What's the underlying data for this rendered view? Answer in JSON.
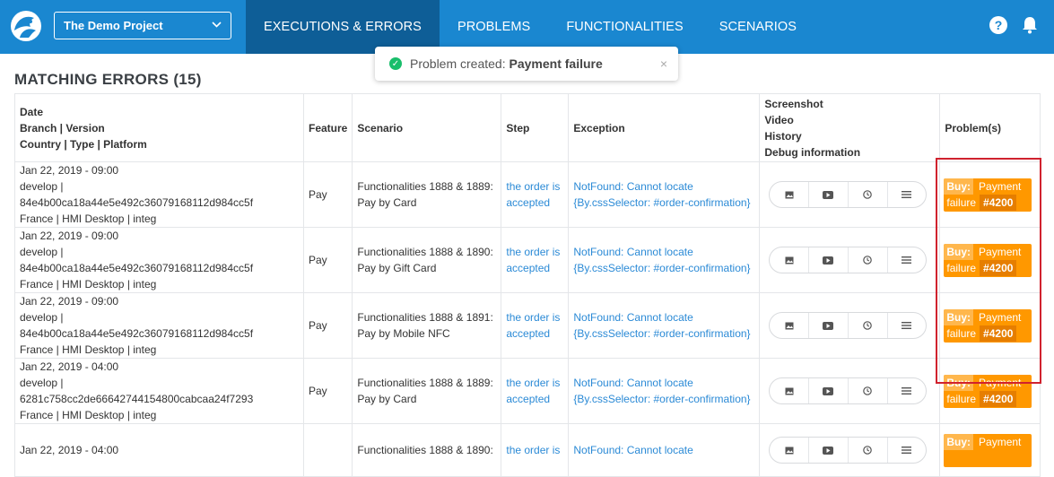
{
  "app": {
    "project": "The Demo Project",
    "nav": [
      {
        "label": "EXECUTIONS & ERRORS"
      },
      {
        "label": "PROBLEMS"
      },
      {
        "label": "FUNCTIONALITIES"
      },
      {
        "label": "SCENARIOS"
      }
    ],
    "help": "?",
    "brand_color": "#1a87d0",
    "active_tab_color": "#0e5e97"
  },
  "toast": {
    "prefix": "Problem created:",
    "name": "Payment failure",
    "close": "×"
  },
  "page": {
    "title": "MATCHING ERRORS (15)"
  },
  "table": {
    "headers": {
      "date": [
        "Date",
        "Branch | Version",
        "Country | Type | Platform"
      ],
      "feature": "Feature",
      "scenario": "Scenario",
      "step": "Step",
      "exception": "Exception",
      "media": [
        "Screenshot",
        "Video",
        "History",
        "Debug information"
      ],
      "problems": "Problem(s)"
    },
    "rows": [
      {
        "date": "Jan 22, 2019 - 09:00",
        "branch": "develop | 84e4b00ca18a44e5e492c36079168112d984cc5f",
        "country": "France | HMI Desktop | integ",
        "feature": "Pay",
        "scenario": [
          "Functionalities 1888 & 1889:",
          "Pay by Card"
        ],
        "step": [
          "the order is",
          "accepted"
        ],
        "exception": [
          "NotFound: Cannot locate",
          "{By.cssSelector: #order-confirmation}"
        ],
        "problem": {
          "tag": "Buy:",
          "name1": "Payment",
          "name2": "failure",
          "id": "#4200"
        }
      },
      {
        "date": "Jan 22, 2019 - 09:00",
        "branch": "develop | 84e4b00ca18a44e5e492c36079168112d984cc5f",
        "country": "France | HMI Desktop | integ",
        "feature": "Pay",
        "scenario": [
          "Functionalities 1888 & 1890:",
          "Pay by Gift Card"
        ],
        "step": [
          "the order is",
          "accepted"
        ],
        "exception": [
          "NotFound: Cannot locate",
          "{By.cssSelector: #order-confirmation}"
        ],
        "problem": {
          "tag": "Buy:",
          "name1": "Payment",
          "name2": "failure",
          "id": "#4200"
        }
      },
      {
        "date": "Jan 22, 2019 - 09:00",
        "branch": "develop | 84e4b00ca18a44e5e492c36079168112d984cc5f",
        "country": "France | HMI Desktop | integ",
        "feature": "Pay",
        "scenario": [
          "Functionalities 1888 & 1891:",
          "Pay by Mobile NFC"
        ],
        "step": [
          "the order is",
          "accepted"
        ],
        "exception": [
          "NotFound: Cannot locate",
          "{By.cssSelector: #order-confirmation}"
        ],
        "problem": {
          "tag": "Buy:",
          "name1": "Payment",
          "name2": "failure",
          "id": "#4200"
        }
      },
      {
        "date": "Jan 22, 2019 - 04:00",
        "branch": "develop | 6281c758cc2de66642744154800cabcaa24f7293",
        "country": "France | HMI Desktop | integ",
        "feature": "Pay",
        "scenario": [
          "Functionalities 1888 & 1889:",
          "Pay by Card"
        ],
        "step": [
          "the order is",
          "accepted"
        ],
        "exception": [
          "NotFound: Cannot locate",
          "{By.cssSelector: #order-confirmation}"
        ],
        "problem": {
          "tag": "Buy:",
          "name1": "Payment",
          "name2": "failure",
          "id": "#4200"
        }
      },
      {
        "date": "Jan 22, 2019 - 04:00",
        "branch": "",
        "country": "",
        "feature": "",
        "scenario": [
          "Functionalities 1888 & 1890:",
          ""
        ],
        "step": [
          "the order is",
          ""
        ],
        "exception": [
          "NotFound: Cannot locate",
          ""
        ],
        "problem": {
          "tag": "Buy:",
          "name1": "Payment",
          "name2": "",
          "id": ""
        }
      }
    ]
  },
  "icons": {
    "screenshot": "image-icon",
    "video": "video-icon",
    "history": "clock-icon",
    "debug": "menu-icon"
  },
  "colors": {
    "problem_badge": "#ff9800",
    "highlight": "#d0222e",
    "link": "#2b8ad6",
    "success": "#19be6b"
  }
}
